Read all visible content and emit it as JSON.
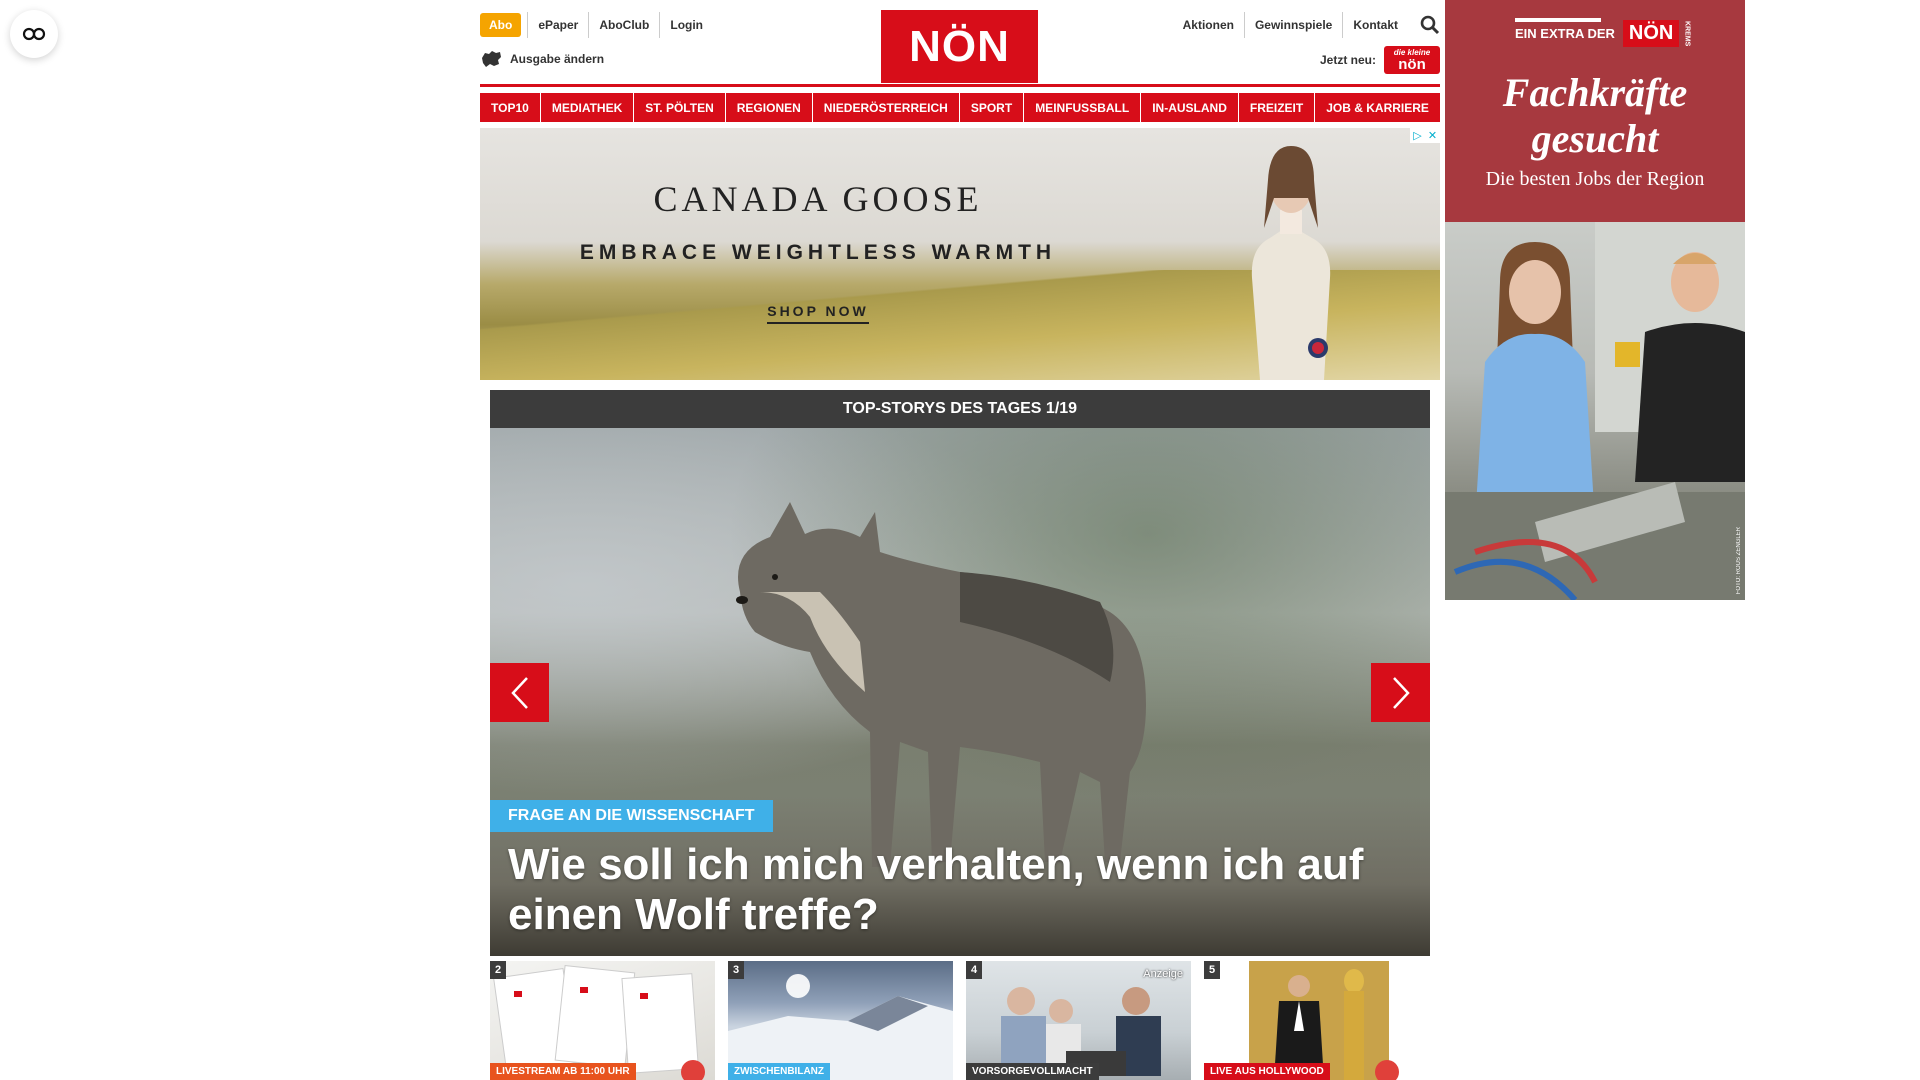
{
  "header": {
    "abo": "Abo",
    "top_links": [
      "ePaper",
      "AboClub",
      "Login"
    ],
    "edition": "Ausgabe ändern",
    "logo": "NÖN",
    "right_links": [
      "Aktionen",
      "Gewinnspiele",
      "Kontakt"
    ],
    "jetzt_neu": "Jetzt neu:",
    "jetzt_badge_small": "die kleine",
    "jetzt_badge_big": "nön"
  },
  "nav": [
    "TOP10",
    "MEDIATHEK",
    "ST. PÖLTEN",
    "REGIONEN",
    "NIEDERÖSTERREICH",
    "SPORT",
    "MEINFUSSBALL",
    "IN-AUSLAND",
    "FREIZEIT",
    "JOB & KARRIERE"
  ],
  "ad_banner": {
    "brand": "CANADA GOOSE",
    "tagline": "EMBRACE WEIGHTLESS WARMTH",
    "cta": "SHOP NOW"
  },
  "stories": {
    "heading": "TOP-STORYS DES TAGES 1/19",
    "hero_tag": "FRAGE AN DIE WISSENSCHAFT",
    "hero_title": "Wie soll ich mich verhalten, wenn ich auf einen Wolf treffe?",
    "thumbs": [
      {
        "num": "2",
        "label": "LIVESTREAM AB 11:00 UHR",
        "label_color": "#e8531e"
      },
      {
        "num": "3",
        "label": "ZWISCHENBILANZ",
        "label_color": "#3fb0e8"
      },
      {
        "num": "4",
        "label": "VORSORGEVOLLMACHT",
        "label_color": "#3c3c3c",
        "badge": "Anzeige"
      },
      {
        "num": "5",
        "label": "LIVE AUS HOLLYWOOD",
        "label_color": "#d70d19"
      }
    ]
  },
  "side_ad": {
    "extra": "EIN EXTRA DER",
    "logo": "NÖN",
    "region": "KREMS",
    "title_line1": "Fachkräfte",
    "title_line2": "gesucht",
    "subtitle": "Die besten Jobs der Region",
    "credit": "FOTO: ROUS ZENGLER"
  },
  "colors": {
    "brand_red": "#d70d19",
    "abo_orange": "#f5a400",
    "tag_blue": "#3fb0e8",
    "side_ad_red": "#a7393f"
  }
}
